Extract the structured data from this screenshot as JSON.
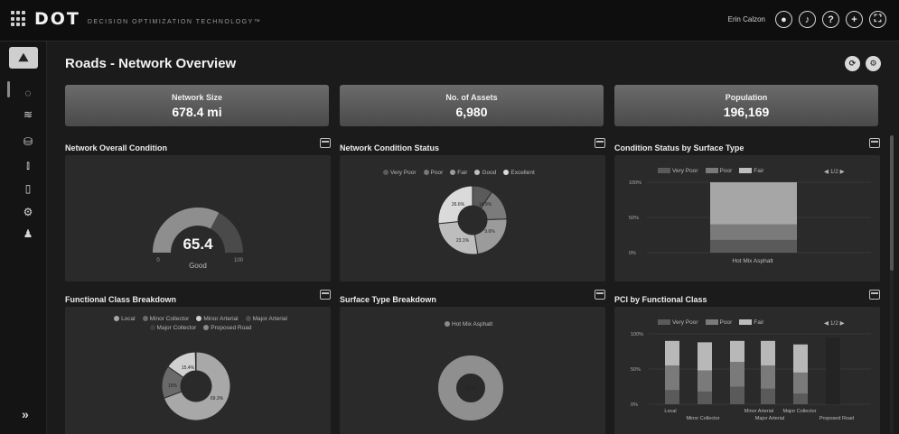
{
  "brand": {
    "logo": "DOT",
    "tagline": "DECISION OPTIMIZATION TECHNOLOGY™"
  },
  "user": {
    "name": "Erin Calzon"
  },
  "header_icons": [
    "user-icon",
    "bell-icon",
    "help-icon",
    "plus-icon",
    "fullscreen-icon"
  ],
  "sidebar": {
    "home_icon": "road-icon",
    "items": [
      "dashboard-icon",
      "layers-icon",
      "database-icon",
      "bar-chart-icon",
      "book-icon",
      "settings-icon",
      "user-icon"
    ],
    "expand_label": "»"
  },
  "page": {
    "title": "Roads - Network Overview"
  },
  "kpis": [
    {
      "label": "Network Size",
      "value": "678.4 mi"
    },
    {
      "label": "No. of Assets",
      "value": "6,980"
    },
    {
      "label": "Population",
      "value": "196,169"
    }
  ],
  "panels": {
    "overall": {
      "title": "Network Overall Condition",
      "value": "65.4",
      "status": "Good",
      "min": "0",
      "max": "100"
    },
    "status": {
      "title": "Network Condition Status",
      "legend": [
        "Very Poor",
        "Poor",
        "Fair",
        "Good",
        "Excellent"
      ],
      "labels": [
        "26.6%",
        "14.9%",
        "23.1%",
        "9.6%"
      ]
    },
    "surface_status": {
      "title": "Condition Status by Surface Type",
      "legend": [
        "Very Poor",
        "Poor",
        "Fair"
      ],
      "pager": "1/2",
      "yticks": [
        "100%",
        "50%",
        "0%"
      ],
      "category": "Hot Mix Asphalt"
    },
    "functional": {
      "title": "Functional Class Breakdown",
      "legend": [
        "Local",
        "Minor Collector",
        "Minor Arterial",
        "Major Arterial",
        "Major Collector",
        "Proposed Road"
      ],
      "labels": [
        "15.4%",
        "15%",
        "69.3%"
      ]
    },
    "surface_type": {
      "title": "Surface Type Breakdown",
      "legend": [
        "Hot Mix Asphalt"
      ],
      "label": "100%"
    },
    "pci": {
      "title": "PCI by Functional Class",
      "legend": [
        "Very Poor",
        "Poor",
        "Fair"
      ],
      "pager": "1/2",
      "yticks": [
        "100%",
        "50%",
        "0%"
      ],
      "categories_top": [
        "Local",
        "Minor Arterial",
        "Major Collector"
      ],
      "categories_bottom": [
        "Minor Collector",
        "Major Arterial",
        "Proposed Road"
      ]
    }
  },
  "chart_data": [
    {
      "type": "pie",
      "title": "Network Condition Status",
      "categories": [
        "Very Poor",
        "Poor",
        "Fair",
        "Good",
        "Excellent"
      ],
      "values": [
        9.6,
        14.9,
        23.1,
        25.8,
        26.6
      ]
    },
    {
      "type": "bar",
      "title": "Condition Status by Surface Type",
      "categories": [
        "Hot Mix Asphalt"
      ],
      "series": [
        {
          "name": "Very Poor",
          "values": [
            18
          ]
        },
        {
          "name": "Poor",
          "values": [
            22
          ]
        },
        {
          "name": "Fair",
          "values": [
            60
          ]
        }
      ],
      "ylim": [
        0,
        100
      ]
    },
    {
      "type": "pie",
      "title": "Functional Class Breakdown",
      "categories": [
        "Local",
        "Minor Collector",
        "Minor Arterial",
        "Major Arterial",
        "Major Collector",
        "Proposed Road"
      ],
      "values": [
        69.3,
        15.4,
        15,
        0.2,
        0.1,
        0
      ]
    },
    {
      "type": "pie",
      "title": "Surface Type Breakdown",
      "categories": [
        "Hot Mix Asphalt"
      ],
      "values": [
        100
      ]
    },
    {
      "type": "bar",
      "title": "PCI by Functional Class",
      "categories": [
        "Local",
        "Minor Collector",
        "Minor Arterial",
        "Major Arterial",
        "Major Collector",
        "Proposed Road"
      ],
      "series": [
        {
          "name": "Very Poor",
          "values": [
            20,
            18,
            25,
            22,
            15,
            0
          ]
        },
        {
          "name": "Poor",
          "values": [
            35,
            30,
            35,
            33,
            30,
            0
          ]
        },
        {
          "name": "Fair",
          "values": [
            35,
            40,
            30,
            35,
            40,
            0
          ]
        }
      ],
      "ylim": [
        0,
        100
      ]
    }
  ]
}
